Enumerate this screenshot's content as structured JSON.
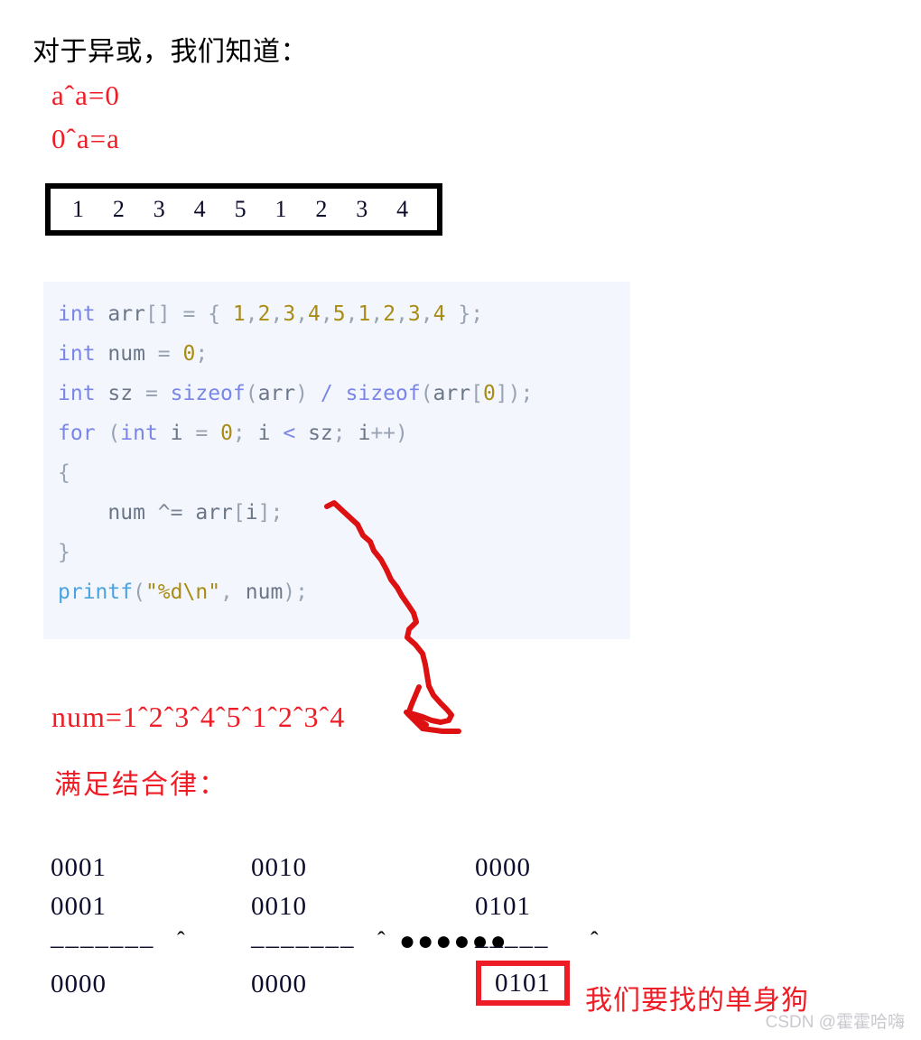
{
  "heading": "对于异或，我们知道：",
  "xor_rules": [
    "aˆa=0",
    "0ˆa=a"
  ],
  "array": {
    "values": [
      "1",
      "2",
      "3",
      "4",
      "5",
      "1",
      "2",
      "3",
      "4"
    ]
  },
  "code": {
    "language": "c",
    "lines": [
      {
        "tokens": [
          {
            "t": "int",
            "c": "k"
          },
          {
            "t": " ",
            "c": "pn"
          },
          {
            "t": "arr",
            "c": "id"
          },
          {
            "t": "[] = { ",
            "c": "pn"
          },
          {
            "t": "1",
            "c": "num"
          },
          {
            "t": ",",
            "c": "pn"
          },
          {
            "t": "2",
            "c": "num"
          },
          {
            "t": ",",
            "c": "pn"
          },
          {
            "t": "3",
            "c": "num"
          },
          {
            "t": ",",
            "c": "pn"
          },
          {
            "t": "4",
            "c": "num"
          },
          {
            "t": ",",
            "c": "pn"
          },
          {
            "t": "5",
            "c": "num"
          },
          {
            "t": ",",
            "c": "pn"
          },
          {
            "t": "1",
            "c": "num"
          },
          {
            "t": ",",
            "c": "pn"
          },
          {
            "t": "2",
            "c": "num"
          },
          {
            "t": ",",
            "c": "pn"
          },
          {
            "t": "3",
            "c": "num"
          },
          {
            "t": ",",
            "c": "pn"
          },
          {
            "t": "4",
            "c": "num"
          },
          {
            "t": " };",
            "c": "pn"
          }
        ]
      },
      {
        "tokens": [
          {
            "t": "int",
            "c": "k"
          },
          {
            "t": " ",
            "c": "pn"
          },
          {
            "t": "num",
            "c": "id"
          },
          {
            "t": " = ",
            "c": "pn"
          },
          {
            "t": "0",
            "c": "num"
          },
          {
            "t": ";",
            "c": "pn"
          }
        ]
      },
      {
        "tokens": [
          {
            "t": "int",
            "c": "k"
          },
          {
            "t": " ",
            "c": "pn"
          },
          {
            "t": "sz",
            "c": "id"
          },
          {
            "t": " = ",
            "c": "pn"
          },
          {
            "t": "sizeof",
            "c": "k"
          },
          {
            "t": "(",
            "c": "pn"
          },
          {
            "t": "arr",
            "c": "id"
          },
          {
            "t": ") ",
            "c": "pn"
          },
          {
            "t": "/",
            "c": "k"
          },
          {
            "t": " ",
            "c": "pn"
          },
          {
            "t": "sizeof",
            "c": "k"
          },
          {
            "t": "(",
            "c": "pn"
          },
          {
            "t": "arr",
            "c": "id"
          },
          {
            "t": "[",
            "c": "pn"
          },
          {
            "t": "0",
            "c": "num"
          },
          {
            "t": "]);",
            "c": "pn"
          }
        ]
      },
      {
        "tokens": [
          {
            "t": "for",
            "c": "k"
          },
          {
            "t": " (",
            "c": "pn"
          },
          {
            "t": "int",
            "c": "k"
          },
          {
            "t": " ",
            "c": "pn"
          },
          {
            "t": "i",
            "c": "id"
          },
          {
            "t": " = ",
            "c": "pn"
          },
          {
            "t": "0",
            "c": "num"
          },
          {
            "t": "; ",
            "c": "pn"
          },
          {
            "t": "i",
            "c": "id"
          },
          {
            "t": " ",
            "c": "pn"
          },
          {
            "t": "<",
            "c": "k"
          },
          {
            "t": " ",
            "c": "pn"
          },
          {
            "t": "sz",
            "c": "id"
          },
          {
            "t": "; ",
            "c": "pn"
          },
          {
            "t": "i",
            "c": "id"
          },
          {
            "t": "++)",
            "c": "pn"
          }
        ]
      },
      {
        "tokens": [
          {
            "t": "{",
            "c": "pn"
          }
        ]
      },
      {
        "tokens": [
          {
            "t": "    ",
            "c": "pn"
          },
          {
            "t": "num",
            "c": "id"
          },
          {
            "t": " ",
            "c": "pn"
          },
          {
            "t": "^=",
            "c": "op"
          },
          {
            "t": " ",
            "c": "pn"
          },
          {
            "t": "arr",
            "c": "id"
          },
          {
            "t": "[",
            "c": "pn"
          },
          {
            "t": "i",
            "c": "id"
          },
          {
            "t": "];",
            "c": "pn"
          }
        ]
      },
      {
        "tokens": [
          {
            "t": "}",
            "c": "pn"
          }
        ]
      },
      {
        "tokens": [
          {
            "t": "printf",
            "c": "fn"
          },
          {
            "t": "(",
            "c": "pn"
          },
          {
            "t": "\"%d\\n\"",
            "c": "str"
          },
          {
            "t": ", ",
            "c": "pn"
          },
          {
            "t": "num",
            "c": "id"
          },
          {
            "t": ");",
            "c": "pn"
          }
        ]
      }
    ]
  },
  "annotations": {
    "formula": "num=1ˆ2ˆ3ˆ4ˆ5ˆ1ˆ2ˆ3ˆ4",
    "associative_note": "满足结合律：",
    "result_caption": "我们要找的单身狗",
    "arrow_color": "#dd1111",
    "red": "#ee1c25"
  },
  "binary_columns": [
    {
      "operand_a": "0001",
      "operand_b": "0001",
      "separator": "–––––––",
      "operator": "ˆ",
      "result": "0000",
      "highlighted": false
    },
    {
      "operand_a": "0010",
      "operand_b": "0010",
      "separator": "–––––––",
      "operator": "ˆ",
      "result": "0000",
      "highlighted": false
    },
    {
      "operand_a": "0000",
      "operand_b": "0101",
      "separator": "–––––",
      "operator": "ˆ",
      "result": "0101",
      "highlighted": true
    }
  ],
  "ellipsis": "●●●●●●",
  "watermark": "CSDN @霍霍哈嗨"
}
